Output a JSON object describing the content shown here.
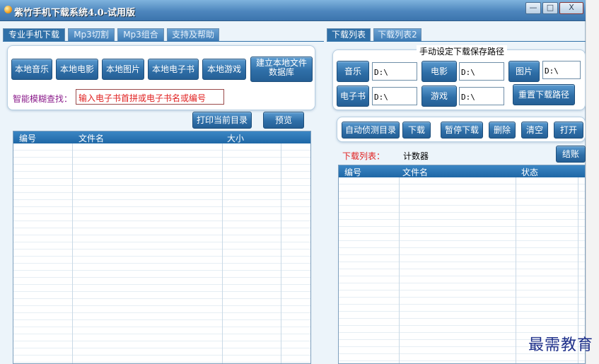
{
  "window": {
    "title": "紫竹手机下载系统4.0-试用版",
    "controls": {
      "minimize": "—",
      "maximize": "□",
      "close": "X"
    }
  },
  "left_tabs": [
    "专业手机下载",
    "Mp3切割",
    "Mp3组合",
    "支持及帮助"
  ],
  "right_tabs": [
    "下载列表",
    "下载列表2"
  ],
  "local": {
    "buttons": [
      "本地音乐",
      "本地电影",
      "本地图片",
      "本地电子书",
      "本地游戏"
    ],
    "build_db_line1": "建立本地文件",
    "build_db_line2": "数据库"
  },
  "search": {
    "label": "智能模糊查找：",
    "placeholder": "输入电子书首拼或电子书名或编号"
  },
  "actions": {
    "print": "打印当前目录",
    "preview": "预览"
  },
  "left_table": {
    "columns": [
      "编号",
      "文件名",
      "大小"
    ]
  },
  "paths": {
    "heading": "手动设定下载保存路径",
    "music_label": "音乐",
    "music_value": "D:\\",
    "movie_label": "电影",
    "movie_value": "D:\\",
    "image_label": "图片",
    "image_value": "D:\\",
    "ebook_label": "电子书",
    "ebook_value": "D:\\",
    "game_label": "游戏",
    "game_value": "D:\\",
    "reset_label": "重置下载路径"
  },
  "download_toolbar": [
    "自动侦测目录",
    "下载",
    "暂停下载",
    "删除",
    "清空",
    "打开"
  ],
  "download_list": {
    "label": "下载列表：",
    "counter": "计数器",
    "settle": "结账",
    "columns": [
      "编号",
      "文件名",
      "状态"
    ]
  },
  "watermark": "最需教育",
  "colors": {
    "title_bar": "#4d86bd",
    "button": "#2f6fa8",
    "red_text": "#e02020",
    "purple_text": "#8a1a8a"
  }
}
